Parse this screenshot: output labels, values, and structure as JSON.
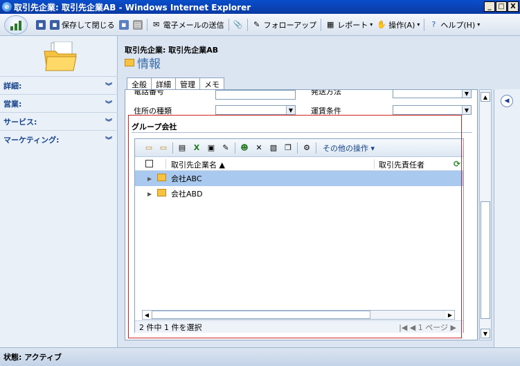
{
  "window": {
    "title": "取引先企業: 取引先企業AB - Windows Internet Explorer",
    "minimize": "_",
    "maximize": "□",
    "close": "X"
  },
  "toolbar": {
    "save_close": "保存して閉じる",
    "send_email": "電子メールの送信",
    "follow_up": "フォローアップ",
    "report": "レポート",
    "actions": "操作(A)",
    "help": "ヘルプ(H)"
  },
  "nav": {
    "groups": [
      "詳細:",
      "営業:",
      "サービス:",
      "マーケティング:"
    ]
  },
  "header": {
    "entity": "取引先企業: 取引先企業AB",
    "section": "情報"
  },
  "tabs": [
    "全般",
    "詳細",
    "管理",
    "メモ"
  ],
  "form": {
    "phone_label": "電話番号",
    "ship_method_label": "発送方法",
    "address_type_label": "住所の種類",
    "freight_terms_label": "運賃条件",
    "section_title": "グループ会社"
  },
  "subgrid": {
    "more_actions": "その他の操作",
    "columns": [
      "取引先企業名",
      "取引先責任者"
    ],
    "rows": [
      {
        "name": "会社ABC",
        "selected": true
      },
      {
        "name": "会社ABD",
        "selected": false
      }
    ],
    "footer_count": "2 件中 1 件を選択",
    "pager_label": "1 ページ"
  },
  "status": {
    "text": "状態: アクティブ"
  },
  "colors": {
    "titlebar": "#0a4ecb",
    "selected_row": "#a9c9ee",
    "highlight_border": "#d02020"
  }
}
